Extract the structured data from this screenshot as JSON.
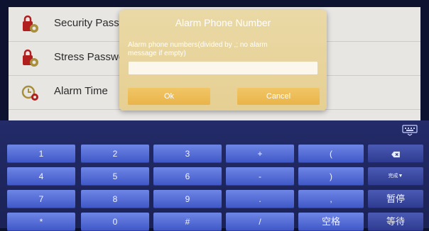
{
  "settings": {
    "items": [
      {
        "label": "Security Password",
        "icon": "lock-gear-icon"
      },
      {
        "label": "Stress Password",
        "icon": "lock-gear-icon"
      },
      {
        "label": "Alarm Time",
        "icon": "clock-gear-icon"
      }
    ]
  },
  "dialog": {
    "title": "Alarm Phone Number",
    "message": "Alarm phone numbers(divided by ,; no alarm message if empty)",
    "input_value": "",
    "ok_label": "Ok",
    "cancel_label": "Cancel"
  },
  "keyboard": {
    "hide_icon": "keyboard-hide-icon",
    "rows": [
      [
        "1",
        "2",
        "3",
        "+",
        "("
      ],
      [
        "4",
        "5",
        "6",
        "-",
        ")"
      ],
      [
        "7",
        "8",
        "9",
        ".",
        ","
      ],
      [
        "*",
        "0",
        "#",
        "/",
        "空格"
      ]
    ],
    "side_keys": [
      "backspace-icon",
      "完成▼",
      "暂停",
      "等待"
    ]
  },
  "colors": {
    "dialog_bg": "#e6cf92",
    "button_bg": "#e9b44a",
    "keyboard_bg": "#1b2256",
    "key_bg": "#3f57c6"
  }
}
